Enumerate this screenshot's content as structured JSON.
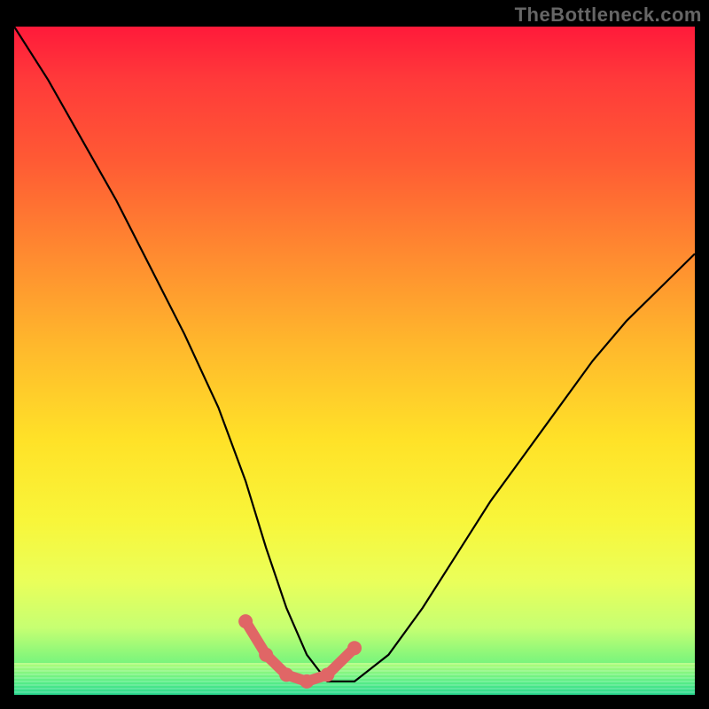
{
  "watermark": "TheBottleneck.com",
  "chart_data": {
    "type": "line",
    "title": "",
    "xlabel": "",
    "ylabel": "",
    "xlim": [
      0,
      100
    ],
    "ylim": [
      0,
      100
    ],
    "grid": false,
    "series": [
      {
        "name": "curve",
        "color": "#000000",
        "x": [
          0,
          5,
          10,
          15,
          20,
          25,
          30,
          34,
          37,
          40,
          43,
          46,
          50,
          55,
          60,
          65,
          70,
          75,
          80,
          85,
          90,
          95,
          100
        ],
        "values": [
          100,
          92,
          83,
          74,
          64,
          54,
          43,
          32,
          22,
          13,
          6,
          2,
          2,
          6,
          13,
          21,
          29,
          36,
          43,
          50,
          56,
          61,
          66
        ]
      }
    ],
    "highlight_region": {
      "name": "optimal-range",
      "color": "#e06666",
      "x": [
        34,
        37,
        40,
        43,
        46,
        50
      ],
      "values": [
        11,
        6,
        3,
        2,
        3,
        7
      ]
    },
    "background_gradient": {
      "direction": "vertical",
      "stops": [
        {
          "pos": 0.0,
          "color": "#ff1a3a"
        },
        {
          "pos": 0.5,
          "color": "#ffc22a"
        },
        {
          "pos": 0.8,
          "color": "#f2ff4a"
        },
        {
          "pos": 1.0,
          "color": "#32e38a"
        }
      ]
    }
  }
}
